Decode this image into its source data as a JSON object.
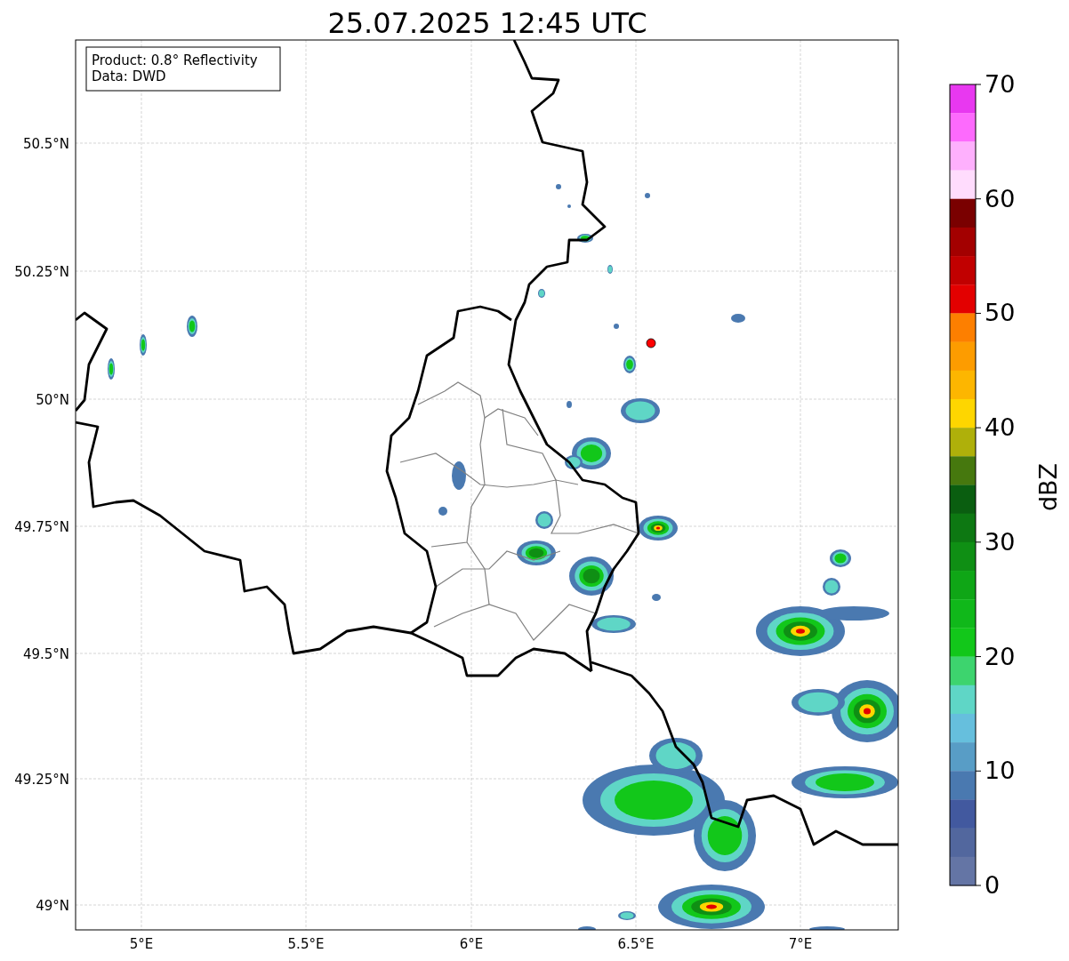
{
  "title": "25.07.2025 12:45 UTC",
  "legend": {
    "lines": [
      "Product: 0.8° Reflectivity",
      "Data: DWD"
    ]
  },
  "lat_ticks": [
    "50.5°N",
    "50.25°N",
    "50°N",
    "49.75°N",
    "49.5°N",
    "49.25°N",
    "49°N"
  ],
  "lon_ticks": [
    "5°E",
    "5.5°E",
    "6°E",
    "6.5°E",
    "7°E"
  ],
  "colorbar": {
    "label": "dBZ",
    "ticks": [
      "70",
      "60",
      "50",
      "40",
      "30",
      "20",
      "10",
      "0"
    ],
    "segments": [
      {
        "color": "#e838f0"
      },
      {
        "color": "#fd6afd"
      },
      {
        "color": "#feb0fd"
      },
      {
        "color": "#ffdcfd"
      },
      {
        "color": "#7a0000"
      },
      {
        "color": "#a30000"
      },
      {
        "color": "#c10000"
      },
      {
        "color": "#e30000"
      },
      {
        "color": "#fd7f00"
      },
      {
        "color": "#fd9c00"
      },
      {
        "color": "#fdb600"
      },
      {
        "color": "#fed600"
      },
      {
        "color": "#afb00a"
      },
      {
        "color": "#46780e"
      },
      {
        "color": "#0a5e10"
      },
      {
        "color": "#0d7812"
      },
      {
        "color": "#0f8f14"
      },
      {
        "color": "#0fa616"
      },
      {
        "color": "#10b81a"
      },
      {
        "color": "#12c71a"
      },
      {
        "color": "#3dd46e"
      },
      {
        "color": "#5fd6c6"
      },
      {
        "color": "#66bfdd"
      },
      {
        "color": "#589dc6"
      },
      {
        "color": "#4a79b0"
      },
      {
        "color": "#42599f"
      },
      {
        "color": "#52679e"
      },
      {
        "color": "#6475a5"
      }
    ]
  }
}
